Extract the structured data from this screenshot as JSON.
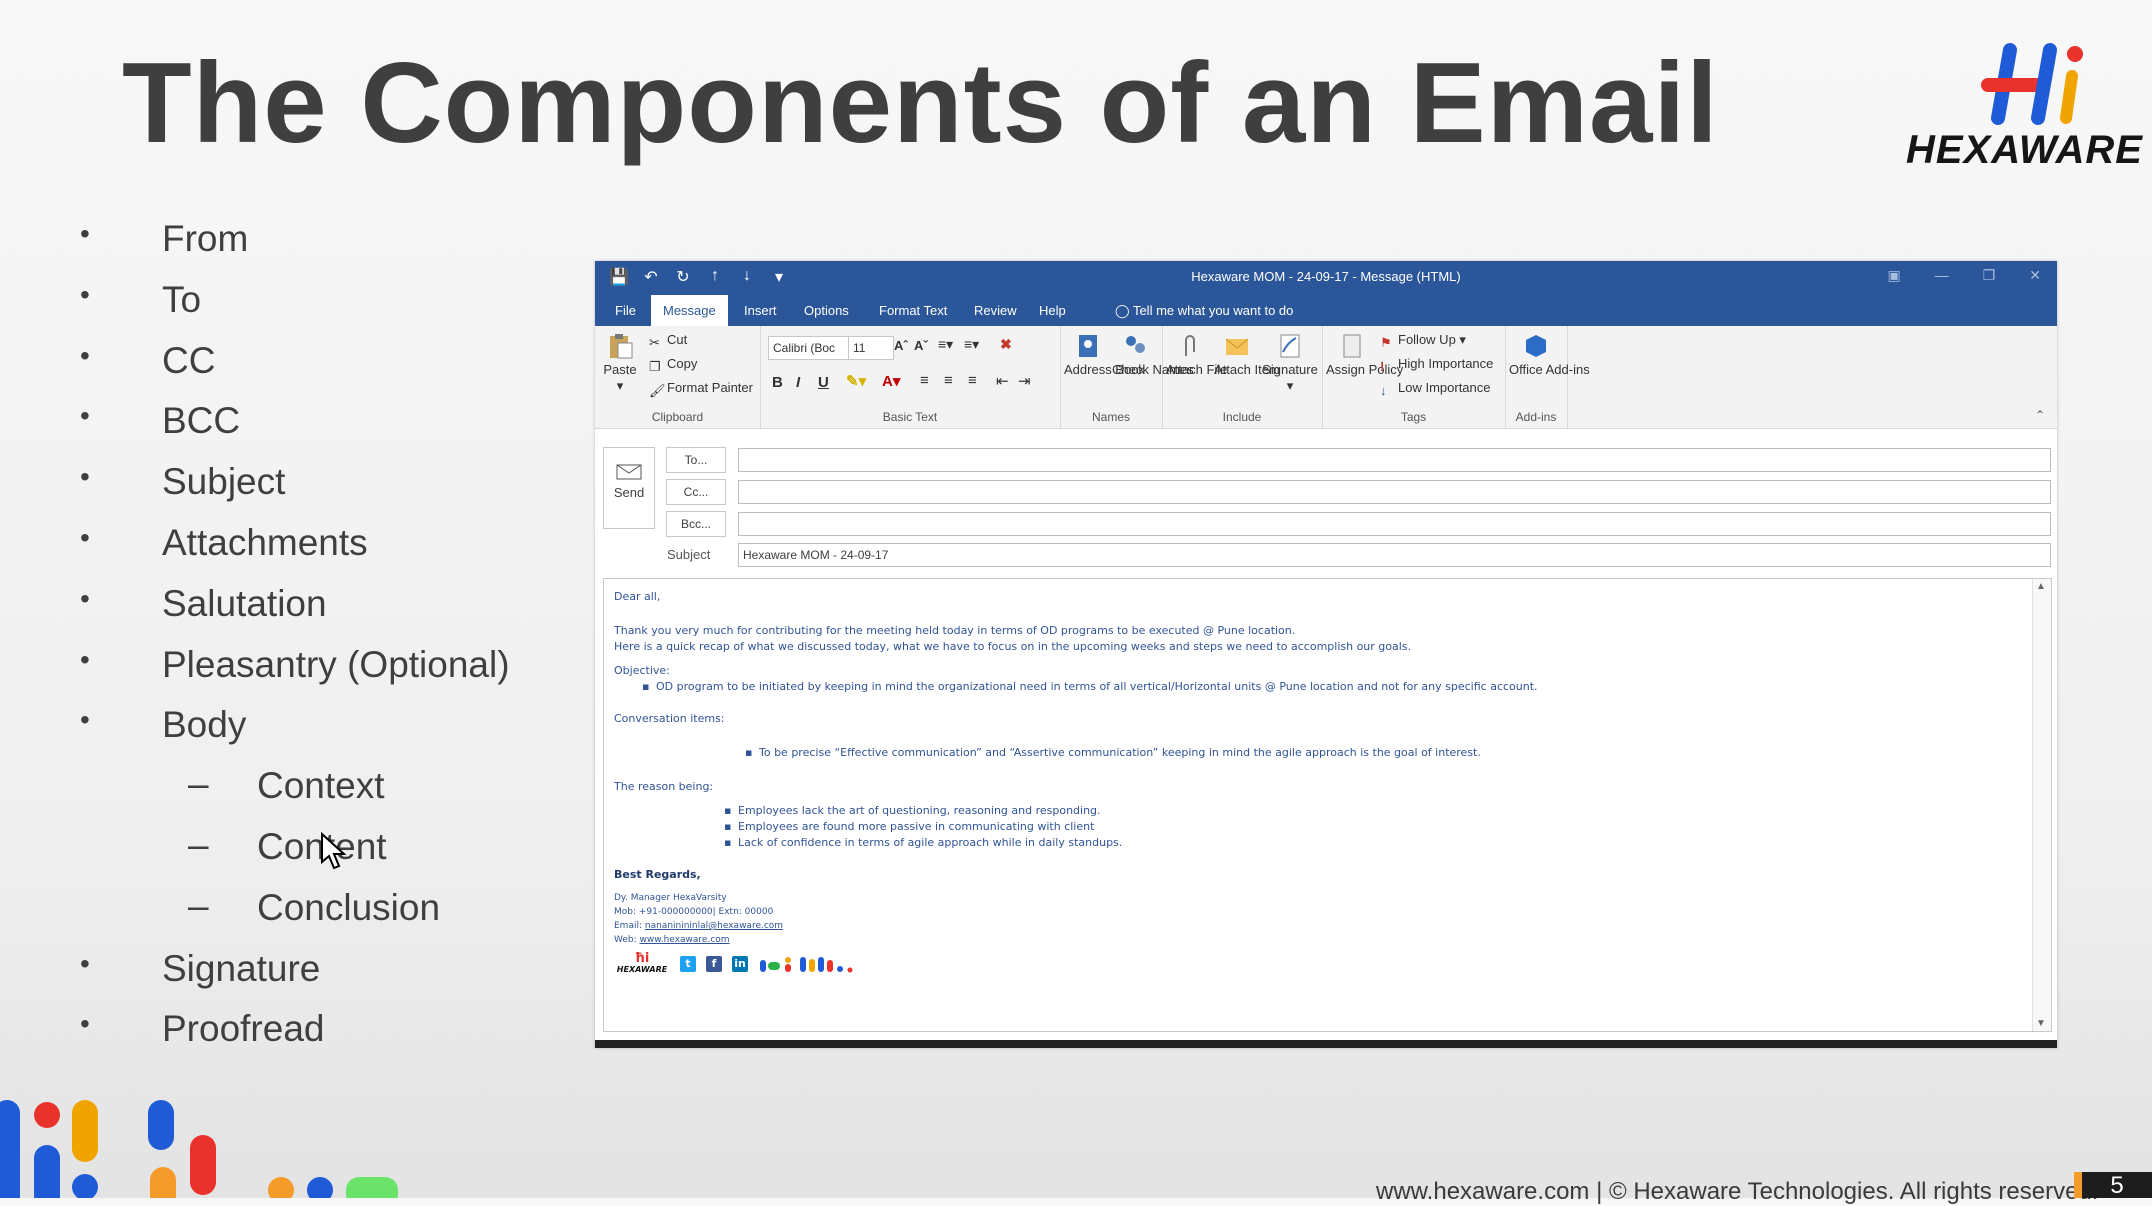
{
  "slide": {
    "title": "The Components of an Email",
    "logo_text": "HEXAWARE",
    "page_number": "5",
    "footer": "www.hexaware.com | © Hexaware Technologies. All rights reserved.",
    "bullets": [
      {
        "text": "From",
        "marker": "•"
      },
      {
        "text": "To",
        "marker": "•"
      },
      {
        "text": "CC",
        "marker": "•"
      },
      {
        "text": "BCC",
        "marker": "•"
      },
      {
        "text": "Subject",
        "marker": "•"
      },
      {
        "text": "Attachments",
        "marker": "•"
      },
      {
        "text": "Salutation",
        "marker": "•"
      },
      {
        "text": "Pleasantry (Optional)",
        "marker": "•"
      },
      {
        "text": "Body",
        "marker": "•"
      },
      {
        "text": "Context",
        "marker": "–"
      },
      {
        "text": "Content",
        "marker": "–"
      },
      {
        "text": "Conclusion",
        "marker": "–"
      },
      {
        "text": "Signature",
        "marker": "•"
      },
      {
        "text": "Proofread",
        "marker": "•"
      }
    ]
  },
  "outlook": {
    "window_title": "Hexaware MOM - 24-09-17  -  Message (HTML)",
    "tabs": [
      "File",
      "Message",
      "Insert",
      "Options",
      "Format Text",
      "Review",
      "Help"
    ],
    "active_tab": "Message",
    "tell_me": "Tell me what you want to do",
    "ribbon": {
      "clipboard": {
        "paste": "Paste",
        "cut": "Cut",
        "copy": "Copy",
        "format_painter": "Format Painter",
        "label": "Clipboard"
      },
      "basic_text": {
        "font": "Calibri (Boc",
        "size": "11",
        "label": "Basic Text"
      },
      "names": {
        "address_book": "Address Book",
        "check_names": "Check Names",
        "label": "Names"
      },
      "include": {
        "attach_file": "Attach File",
        "attach_item": "Attach Item",
        "signature": "Signature",
        "label": "Include"
      },
      "tags": {
        "assign_policy": "Assign Policy",
        "follow_up": "Follow Up",
        "high": "High Importance",
        "low": "Low Importance",
        "label": "Tags"
      },
      "addins": {
        "office_addins": "Office Add-ins",
        "label": "Add-ins"
      }
    },
    "send_label": "Send",
    "to_label": "To...",
    "cc_label": "Cc...",
    "bcc_label": "Bcc...",
    "subject_label": "Subject",
    "subject_value": "Hexaware MOM - 24-09-17",
    "body": {
      "greeting": "Dear all,",
      "line1": "Thank you very much for contributing for the meeting held today in terms of OD programs to be executed @ Pune location.",
      "line2": "Here is a quick recap of what we discussed today, what we have to focus on in the upcoming weeks and steps we need to accomplish our goals.",
      "objective_heading": "Objective:",
      "objective_item": "OD program to be initiated by keeping in mind the organizational need in terms of all vertical/Horizontal units @ Pune location and not for any specific account.",
      "conversation_heading": "Conversation items:",
      "conversation_item": "To be precise “Effective communication” and “Assertive communication” keeping in mind the agile approach is the goal of interest.",
      "reason_heading": "The reason being:",
      "reasons": [
        "Employees lack the art of questioning, reasoning and responding.",
        "Employees are found more passive in communicating with client",
        "Lack of confidence in terms of agile approach while in daily standups."
      ],
      "regards": "Best Regards,",
      "sig_title": "Dy. Manager HexaVarsity",
      "sig_mob": "Mob: +91-000000000| Extn: 00000",
      "sig_email_label": "Email: ",
      "sig_email": "nananinininlal@hexaware.com",
      "sig_web_label": "Web: ",
      "sig_web": "www.hexaware.com",
      "sig_logo": "HEXAWARE"
    }
  },
  "colors": {
    "ribbon_blue": "#2b579a",
    "body_text": "#2f5496",
    "title": "#3f3f3f",
    "accent_orange": "#f59b2a"
  }
}
